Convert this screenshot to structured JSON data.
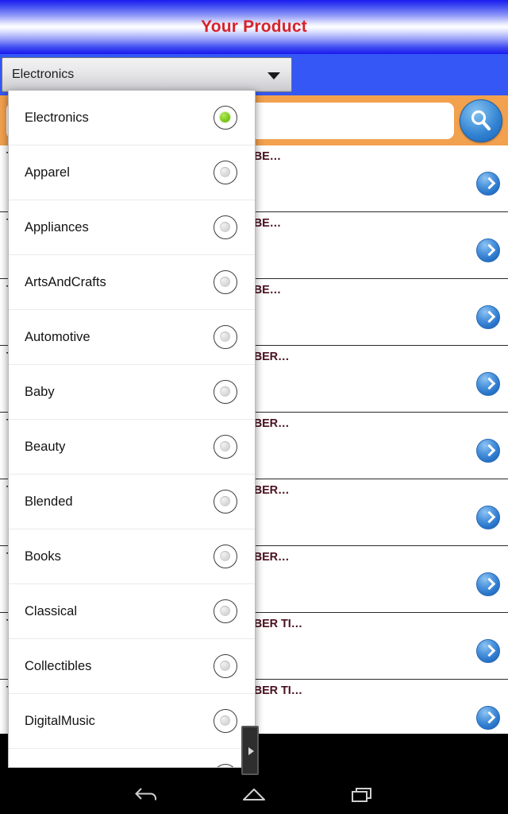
{
  "app": {
    "title": "Your Product"
  },
  "spinner": {
    "selected": "Electronics",
    "caret_icon": "chevron-down-icon"
  },
  "search": {
    "value": "",
    "placeholder": "",
    "button_icon": "search-icon"
  },
  "product_list": {
    "row_arrow_icon": "chevron-right-circle-icon",
    "rows": [
      {
        "title": "TOUCH SENSITIVE / CONDUCTIVE HYBRID FIBE…"
      },
      {
        "title": "TOUCH SENSITIVE / CONDUCTIVE HYBRID FIBE…"
      },
      {
        "title": "TOUCH SENSITIVE / CONDUCTIVE HYBRID FIBE…"
      },
      {
        "title": "TOUCH SENSITIVE / CONDUCTIVE HYBRID FIBER…"
      },
      {
        "title": "TOUCH SENSITIVE / CONDUCTIVE HYBRID FIBER…"
      },
      {
        "title": "TOUCH SENSITIVE / CONDUCTIVE HYBRID FIBER…"
      },
      {
        "title": "TOUCH SENSITIVE / CONDUCTIVE HYBRID FIBER…"
      },
      {
        "title": "TOUCH SENSITIVE / CONDUCTIVE HYBRID FIBER TI…"
      },
      {
        "title": "TOUCH SENSITIVE / CONDUCTIVE HYBRID FIBER TI…"
      }
    ]
  },
  "dropdown": {
    "items": [
      {
        "label": "Electronics",
        "selected": true
      },
      {
        "label": "Apparel",
        "selected": false
      },
      {
        "label": "Appliances",
        "selected": false
      },
      {
        "label": "ArtsAndCrafts",
        "selected": false
      },
      {
        "label": "Automotive",
        "selected": false
      },
      {
        "label": "Baby",
        "selected": false
      },
      {
        "label": "Beauty",
        "selected": false
      },
      {
        "label": "Blended",
        "selected": false
      },
      {
        "label": "Books",
        "selected": false
      },
      {
        "label": "Classical",
        "selected": false
      },
      {
        "label": "Collectibles",
        "selected": false
      },
      {
        "label": "DigitalMusic",
        "selected": false
      },
      {
        "label": "",
        "selected": false
      }
    ]
  },
  "navbar": {
    "back_label": "back-icon",
    "home_label": "home-icon",
    "recents_label": "recents-icon"
  },
  "colors": {
    "title_text": "#d8222a",
    "spinner_band": "#3457f5",
    "search_bar": "#f2a14e",
    "row_title": "#4a1120",
    "radio_selected": "#7fcc1c",
    "arrow_button": "#2a76cb"
  }
}
